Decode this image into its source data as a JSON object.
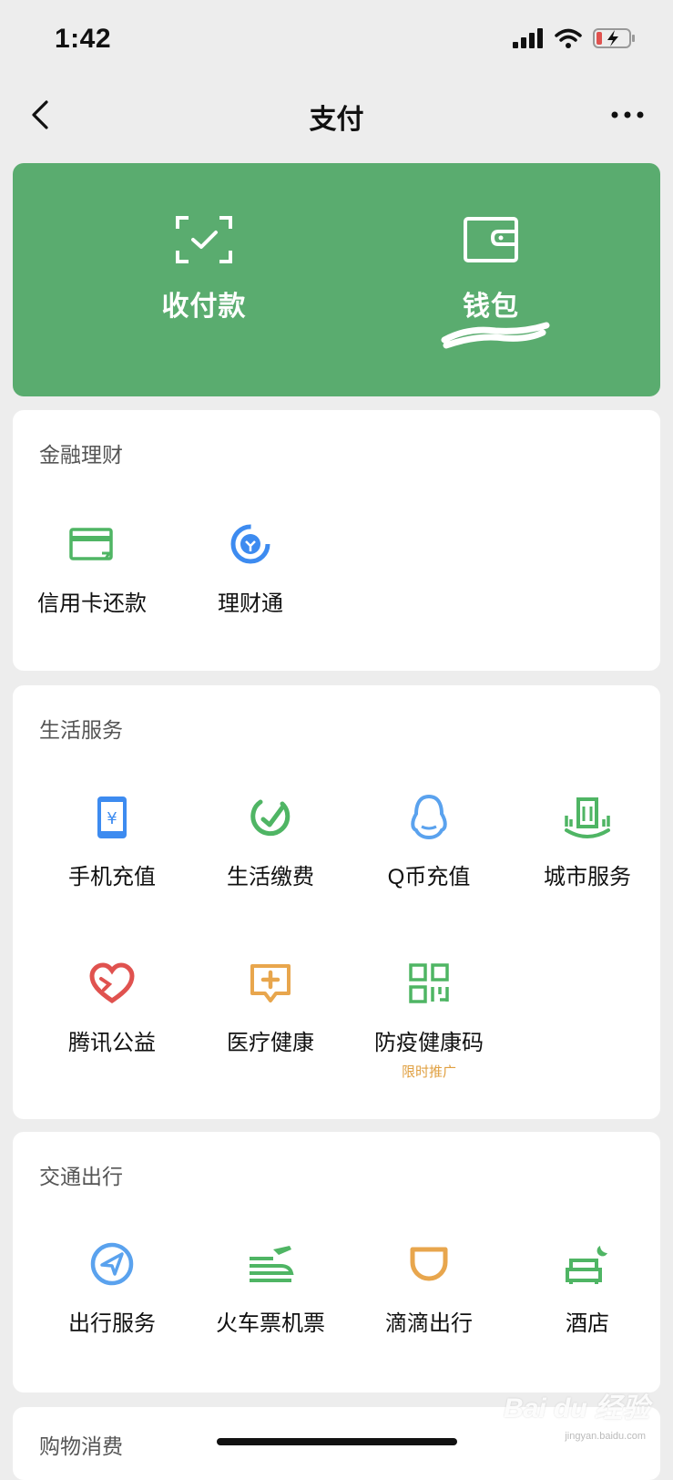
{
  "status_bar": {
    "time": "1:42"
  },
  "nav": {
    "title": "支付"
  },
  "hero": {
    "pay_label": "收付款",
    "wallet_label": "钱包"
  },
  "sections": {
    "finance": {
      "title": "金融理财",
      "items": [
        {
          "label": "信用卡还款",
          "icon": "credit-card-icon"
        },
        {
          "label": "理财通",
          "icon": "wealth-icon"
        }
      ]
    },
    "life": {
      "title": "生活服务",
      "items": [
        {
          "label": "手机充值",
          "icon": "phone-topup-icon"
        },
        {
          "label": "生活缴费",
          "icon": "utility-bill-icon"
        },
        {
          "label": "Q币充值",
          "icon": "qq-penguin-icon"
        },
        {
          "label": "城市服务",
          "icon": "city-service-icon"
        },
        {
          "label": "腾讯公益",
          "icon": "charity-heart-icon"
        },
        {
          "label": "医疗健康",
          "icon": "medical-icon"
        },
        {
          "label": "防疫健康码",
          "icon": "qr-code-icon",
          "sub": "限时推广"
        }
      ]
    },
    "transport": {
      "title": "交通出行",
      "items": [
        {
          "label": "出行服务",
          "icon": "navigation-icon"
        },
        {
          "label": "火车票机票",
          "icon": "train-plane-icon"
        },
        {
          "label": "滴滴出行",
          "icon": "didi-icon"
        },
        {
          "label": "酒店",
          "icon": "hotel-bed-icon"
        }
      ]
    },
    "shopping": {
      "title": "购物消费"
    }
  },
  "watermark": {
    "text": "Bai du 经验",
    "sub": "jingyan.baidu.com"
  },
  "colors": {
    "hero_green": "#5aac6f",
    "icon_green": "#4fb564",
    "icon_blue": "#3d8bf0",
    "icon_light_blue": "#5aa2ee",
    "icon_red": "#e0524f",
    "icon_orange": "#e8a64d",
    "promo_orange": "#e0a042"
  }
}
